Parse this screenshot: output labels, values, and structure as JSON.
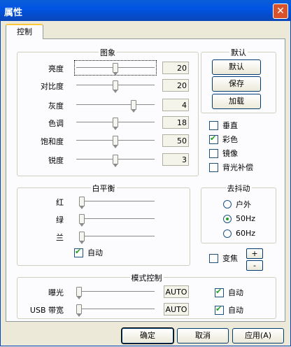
{
  "window": {
    "title": "属性",
    "close_glyph": "✕"
  },
  "tabs": [
    {
      "label": "控制"
    }
  ],
  "image_group": {
    "title": "图象",
    "sliders": [
      {
        "label": "亮度",
        "value": "20",
        "fraction": 0.5
      },
      {
        "label": "对比度",
        "value": "20",
        "fraction": 0.5
      },
      {
        "label": "灰度",
        "value": "4",
        "fraction": 0.75
      },
      {
        "label": "色调",
        "value": "18",
        "fraction": 0.5
      },
      {
        "label": "饱和度",
        "value": "50",
        "fraction": 0.5
      },
      {
        "label": "锐度",
        "value": "3",
        "fraction": 0.5
      }
    ]
  },
  "default_group": {
    "title": "默认",
    "buttons": [
      "默认",
      "保存",
      "加载"
    ]
  },
  "options": [
    {
      "label": "垂直",
      "checked": false
    },
    {
      "label": "彩色",
      "checked": true
    },
    {
      "label": "镜像",
      "checked": false
    },
    {
      "label": "背光补偿",
      "checked": false
    }
  ],
  "white_balance": {
    "title": "白平衡",
    "sliders": [
      {
        "label": "红",
        "fraction": 0.0
      },
      {
        "label": "绿",
        "fraction": 0.0
      },
      {
        "label": "兰",
        "fraction": 0.0
      }
    ],
    "auto": {
      "label": "自动",
      "checked": true
    }
  },
  "deflicker": {
    "title": "去抖动",
    "options": [
      {
        "label": "户外",
        "selected": false
      },
      {
        "label": "50Hz",
        "selected": true
      },
      {
        "label": "60Hz",
        "selected": false
      }
    ]
  },
  "zoom": {
    "label": "变焦",
    "checked": false,
    "plus": "+",
    "minus": "-"
  },
  "mode_control": {
    "title": "模式控制",
    "rows": [
      {
        "label": "曝光",
        "value": "AUTO",
        "fraction": 0.0,
        "auto_label": "自动",
        "auto": true
      },
      {
        "label": "USB 带宽",
        "value": "AUTO",
        "fraction": 0.0,
        "auto_label": "自动",
        "auto": true
      }
    ]
  },
  "footer": {
    "ok": "确定",
    "cancel": "取消",
    "apply": "应用(A)"
  }
}
